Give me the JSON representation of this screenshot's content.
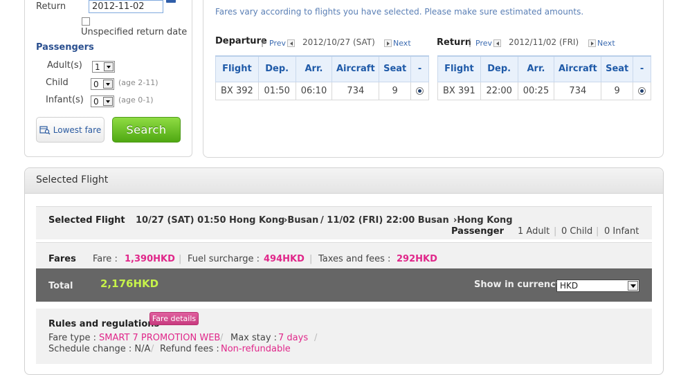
{
  "search": {
    "return_label": "Return",
    "return_date": "2012-11-02",
    "unspecified_label": "Unspecified return date",
    "passengers_title": "Passengers",
    "adults_label": "Adult(s)",
    "adults_value": "1",
    "child_label": "Child",
    "child_value": "0",
    "child_age": "(age 2-11)",
    "infant_label": "Infant(s)",
    "infant_value": "0",
    "infant_age": "(age 0-1)",
    "lowest_fare_label": "Lowest fare",
    "search_label": "Search"
  },
  "fares": {
    "notice": "Fares vary according to flights you have selected. Please make sure estimated amounts.",
    "prev_label": "Prev",
    "next_label": "Next",
    "columns": [
      "Flight",
      "Dep.",
      "Arr.",
      "Aircraft",
      "Seat",
      "-"
    ],
    "departure": {
      "title": "Departure",
      "date": "2012/10/27 (SAT)",
      "row": {
        "flight": "BX 392",
        "dep": "01:50",
        "arr": "06:10",
        "aircraft": "734",
        "seat": "9"
      }
    },
    "return": {
      "title": "Return",
      "date": "2012/11/02 (FRI)",
      "row": {
        "flight": "BX 391",
        "dep": "22:00",
        "arr": "00:25",
        "aircraft": "734",
        "seat": "9"
      }
    }
  },
  "selected": {
    "section_title": "Selected Flight",
    "label": "Selected Flight",
    "outbound": "10/27 (SAT) 01:50 Hong Kong",
    "outbound_dest": "Busan",
    "inbound": "/ 11/02 (FRI) 22:00 Busan",
    "inbound_dest": "Hong Kong",
    "passenger_label": "Passenger",
    "adults": "1 Adult",
    "children": "0 Child",
    "infants": "0 Infant",
    "fares_label": "Fares",
    "fare_label": "Fare :",
    "fare_value": "1,390HKD",
    "fuel_label": "Fuel surcharge :",
    "fuel_value": "494HKD",
    "tax_label": "Taxes and fees :",
    "tax_value": "292HKD",
    "total_label": "Total",
    "total_value": "2,176HKD",
    "currency_label": "Show in currency",
    "currency_value": "HKD",
    "rules_label": "Rules and regulations",
    "fare_details_label": "Fare details",
    "fare_type_label": "Fare type :",
    "fare_type_value": "SMART 7 PROMOTION WEB",
    "max_stay_label": "Max stay :",
    "max_stay_value": "7 days",
    "schedule_change_label": "Schedule change : N/A",
    "refund_label": "Refund fees :",
    "refund_value": "Non-refundable"
  },
  "colors": {
    "accent_blue": "#1f5aa8",
    "search_green": "#4fa812",
    "price_pink": "#e0278a",
    "total_green": "#c6f24a",
    "total_bar": "#666666"
  }
}
